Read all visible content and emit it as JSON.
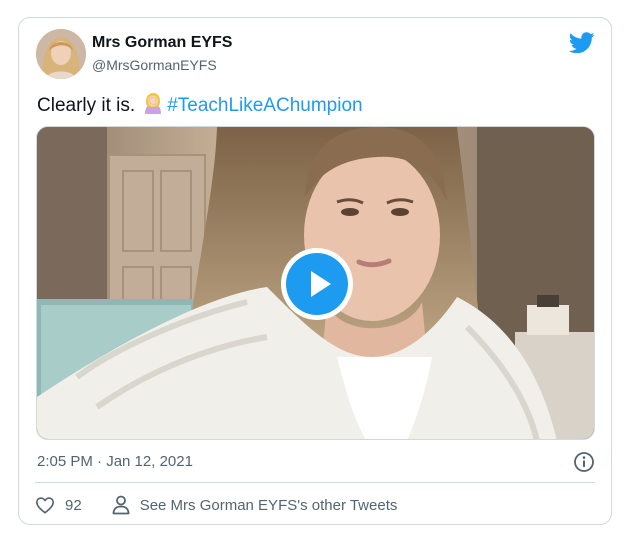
{
  "author": {
    "name": "Mrs Gorman EYFS",
    "handle": "@MrsGormanEYFS"
  },
  "tweet": {
    "text": "Clearly it is.",
    "emoji": "woman-facepalming-emoji",
    "hashtag": "#TeachLikeAChumpion"
  },
  "media": {
    "type": "video",
    "play_icon": "play-icon"
  },
  "meta": {
    "timestamp": "2:05 PM · Jan 12, 2021"
  },
  "actions": {
    "like_count": "92",
    "other_tweets_label": "See Mrs Gorman EYFS's other Tweets"
  },
  "colors": {
    "twitter_blue": "#1d9bf0",
    "text_primary": "#0f1419",
    "text_secondary": "#536471",
    "border": "#cfd9de"
  },
  "icons": {
    "brand": "twitter-bird-icon",
    "info": "info-icon",
    "like": "heart-icon",
    "profile": "person-icon"
  }
}
